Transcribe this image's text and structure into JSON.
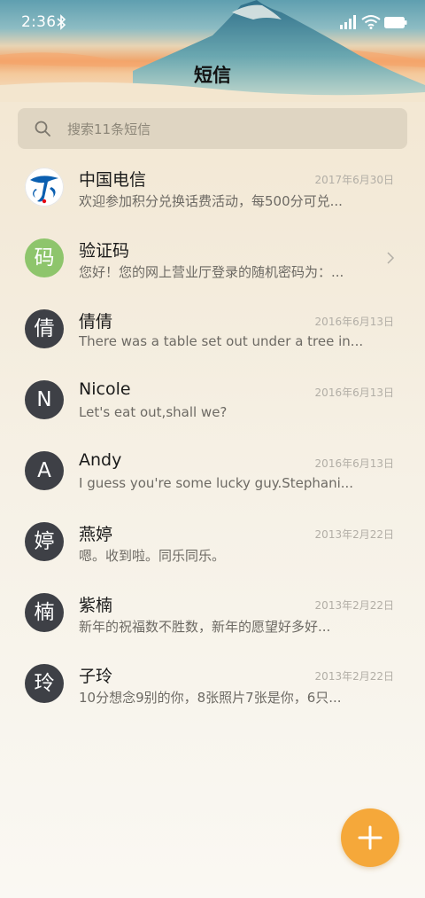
{
  "status": {
    "time": "2:36"
  },
  "title": "短信",
  "search": {
    "placeholder": "搜索11条短信"
  },
  "conversations": [
    {
      "avatar_text": "",
      "avatar_type": "telecom-logo",
      "name": "中国电信",
      "date": "2017年6月30日",
      "preview": "欢迎参加积分兑换话费活动，每500分可兑..."
    },
    {
      "avatar_text": "码",
      "avatar_type": "green",
      "name": "验证码",
      "date": "",
      "preview": "您好！您的网上营业厅登录的随机密码为：..."
    },
    {
      "avatar_text": "倩",
      "avatar_type": "dark",
      "name": "倩倩",
      "date": "2016年6月13日",
      "preview": "There was a table set out under a tree in..."
    },
    {
      "avatar_text": "N",
      "avatar_type": "dark",
      "name": "Nicole",
      "date": "2016年6月13日",
      "preview": "Let's eat out,shall we?"
    },
    {
      "avatar_text": "A",
      "avatar_type": "dark",
      "name": "Andy",
      "date": "2016年6月13日",
      "preview": "I guess you're some lucky guy.Stephani..."
    },
    {
      "avatar_text": "婷",
      "avatar_type": "dark",
      "name": "燕婷",
      "date": "2013年2月22日",
      "preview": "嗯。收到啦。同乐同乐。"
    },
    {
      "avatar_text": "楠",
      "avatar_type": "dark",
      "name": "紫楠",
      "date": "2013年2月22日",
      "preview": "新年的祝福数不胜数，新年的愿望好多好..."
    },
    {
      "avatar_text": "玲",
      "avatar_type": "dark",
      "name": "子玲",
      "date": "2013年2月22日",
      "preview": "10分想念9别的你，8张照片7张是你，6只..."
    }
  ],
  "colors": {
    "accent": "#f5a83a",
    "avatar_dark": "#3e4046",
    "avatar_green": "#8ec56c",
    "telecom_blue": "#0b5fb0"
  },
  "icons": {
    "bluetooth": "bluetooth-icon",
    "signal": "signal-icon",
    "wifi": "wifi-icon",
    "battery": "battery-icon",
    "search": "search-icon",
    "chevron": "chevron-right-icon",
    "compose": "plus-icon"
  }
}
